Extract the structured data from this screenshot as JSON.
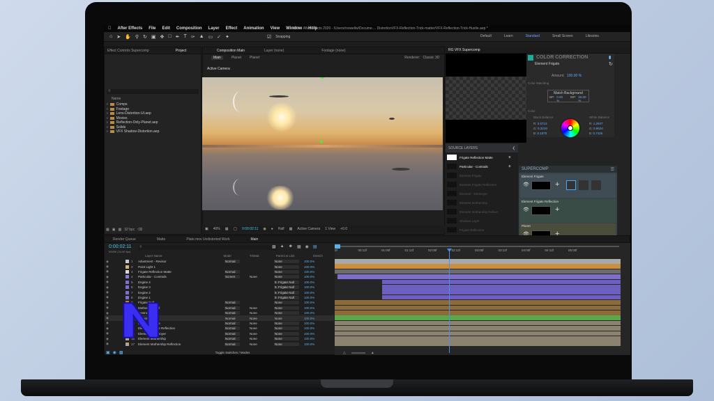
{
  "app": {
    "name": "After Effects",
    "menu": [
      "File",
      "Edit",
      "Composition",
      "Layer",
      "Effect",
      "Animation",
      "View",
      "Window",
      "Help"
    ],
    "window_title": "Adobe After Effects 2020 - /Users/roswellw/Docume.... DistortionVFX-Reflection-Trick-matter/VFX-Reflection-Trick-Hustle.aep *",
    "snapping": "Snapping",
    "workspaces": [
      "Default",
      "Learn",
      "Standard",
      "Small Screen",
      "Libraries"
    ]
  },
  "project": {
    "tabs": [
      "Effect Controls Supercomp",
      "Project"
    ],
    "search_placeholder": "",
    "col_name": "Name",
    "folders": [
      "Comps",
      "Footage",
      "Lens-Distortion-UI.aep",
      "Movies",
      "Reflection-Only-Planet.aep",
      "Solids",
      "VFX Shadow-Distortion.aep"
    ],
    "footer_bpc": "32 bpc"
  },
  "composition": {
    "tab": "Composition Main",
    "layer_tab": "Layer (none)",
    "footage_tab": "Footage (none)",
    "subtabs": [
      "Main",
      "Planet",
      "Planet"
    ],
    "renderer_label": "Renderer:",
    "renderer": "Classic 3D",
    "camera": "Active Camera",
    "zoom": "40%",
    "timecode": "0:00:02:11",
    "resolution": "Half",
    "view_camera": "Active Camera",
    "views": "1 View",
    "exposure": "+0.0"
  },
  "vfx": {
    "tab": "RG VFX Supercomp",
    "cc_title": "COLOR CORRECTION",
    "element": "Element Frigate",
    "amount_label": "Amount:",
    "amount": "100.00 %",
    "match_label": "Color Matching",
    "match_bg": "Match Background",
    "bp_label": "BP:",
    "bp": "0.00 %",
    "wp_label": "WP:",
    "wp": "33.00 %",
    "color_label": "Color",
    "black_label": "Black Balance",
    "white_label": "White Balance",
    "rgb": [
      {
        "k": "R:",
        "v": "1.2947"
      },
      {
        "k": "G:",
        "v": "0.9624"
      },
      {
        "k": "B:",
        "v": "0.7426"
      }
    ],
    "rgb2": [
      {
        "k": "R:",
        "v": "0.5713"
      },
      {
        "k": "G:",
        "v": "0.3219"
      },
      {
        "k": "B:",
        "v": "0.1870"
      }
    ],
    "source_layers": "SOURCE LAYERS",
    "sources": [
      "Frigate Reflection Matte",
      "Particular - Contrails",
      "Element Frigate",
      "Element Frigate Reflection",
      "Element - Destroyer",
      "Element Mothership",
      "Element Mothership Reflect",
      "Shadow Layer",
      "Frigate Reflection"
    ],
    "supercomp": "SUPERCOMP",
    "slots": [
      "Element Frigate",
      "Element Frigate Reflection",
      "Planet",
      "Knoll Sun"
    ]
  },
  "timeline": {
    "tabs": [
      "Render Queue",
      "Matte",
      "Plate.mov Undistorted Work",
      "Main"
    ],
    "timecode": "0:00:02:11",
    "fps": "00059 (24.00 fps)",
    "headers": {
      "name": "Layer Name",
      "mode": "Mode",
      "t": "T",
      "trkmat": "TrkMat",
      "parent": "Parent & Link",
      "stretch": "Stretch"
    },
    "layers": [
      {
        "n": "1",
        "name": "Adustment - Revisor",
        "mode": "Normal",
        "mat": "",
        "par": "None",
        "st": "100.0%",
        "c": "#c9c9c9"
      },
      {
        "n": "2",
        "name": "Point Light 1",
        "mode": "",
        "mat": "",
        "par": "None",
        "st": "100.0%",
        "c": "#d5b27a"
      },
      {
        "n": "3",
        "name": "Frigate Reflection Matte",
        "mode": "Normal",
        "mat": "",
        "par": "None",
        "st": "100.0%",
        "c": "#d8d8d8"
      },
      {
        "n": "4",
        "name": "Particular - Contrails",
        "mode": "Screen",
        "mat": "None",
        "par": "None",
        "st": "100.0%",
        "c": "#8c7bd6"
      },
      {
        "n": "5",
        "name": "Engine 4",
        "mode": "",
        "mat": "",
        "par": "9. Frigate Null",
        "st": "100.0%",
        "c": "#7b6fd0"
      },
      {
        "n": "6",
        "name": "Engine 3",
        "mode": "",
        "mat": "",
        "par": "9. Frigate Null",
        "st": "100.0%",
        "c": "#7b6fd0"
      },
      {
        "n": "7",
        "name": "Engine 2",
        "mode": "",
        "mat": "",
        "par": "9. Frigate Null",
        "st": "100.0%",
        "c": "#7b6fd0"
      },
      {
        "n": "8",
        "name": "Engine 1",
        "mode": "",
        "mat": "",
        "par": "9. Frigate Null",
        "st": "100.0%",
        "c": "#7b6fd0"
      },
      {
        "n": "9",
        "name": "Frigate Null",
        "mode": "Normal",
        "mat": "",
        "par": "None",
        "st": "100.0%",
        "c": "#b07c40"
      },
      {
        "n": "10",
        "name": "Mothership Null",
        "mode": "Normal",
        "mat": "None",
        "par": "None",
        "st": "100.0%",
        "c": "#b07c40"
      },
      {
        "n": "11",
        "name": "Destroyer Null",
        "mode": "Normal",
        "mat": "None",
        "par": "None",
        "st": "100.0%",
        "c": "#b07c40"
      },
      {
        "n": "12",
        "name": "[Supercomp]",
        "mode": "Normal",
        "mat": "None",
        "par": "None",
        "st": "100.0%",
        "c": "#5e9c4e"
      },
      {
        "n": "13",
        "name": "Element Frigate",
        "mode": "Normal",
        "mat": "None",
        "par": "None",
        "st": "100.0%",
        "c": "#b0a48c"
      },
      {
        "n": "14",
        "name": "Element Frigate Reflection",
        "mode": "Normal",
        "mat": "None",
        "par": "None",
        "st": "100.0%",
        "c": "#b0a48c"
      },
      {
        "n": "15",
        "name": "Element - Destroyer",
        "mode": "Normal",
        "mat": "None",
        "par": "None",
        "st": "100.0%",
        "c": "#b0a48c"
      },
      {
        "n": "16",
        "name": "Element Mothership",
        "mode": "Normal",
        "mat": "None",
        "par": "None",
        "st": "100.0%",
        "c": "#b0a48c"
      },
      {
        "n": "17",
        "name": "Element Mothership Reflection",
        "mode": "Normal",
        "mat": "None",
        "par": "None",
        "st": "100.0%",
        "c": "#b0a48c"
      }
    ],
    "ruler": [
      "0f",
      "00:12f",
      "01:00f",
      "01:12f",
      "02:00f",
      "02:12f",
      "03:00f",
      "03:12f",
      "04:00f",
      "04:12f",
      "05:00f"
    ],
    "toggle": "Toggle Switches / Modes"
  },
  "colors": {
    "accent": "#4a8fe8",
    "playhead": "#4a8fe8",
    "logo": "#3a2ef0"
  }
}
